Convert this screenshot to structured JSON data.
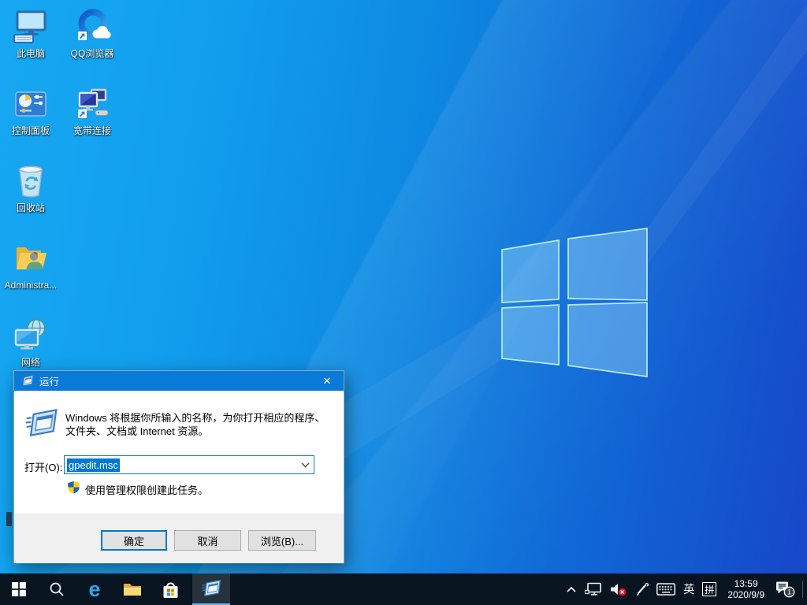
{
  "colors": {
    "accent": "#0078d7",
    "titlebar_blue": "#0a7ad9",
    "taskbar_bg": "#081420",
    "wallpaper_left": "#16a7f2",
    "wallpaper_right": "#1747c8",
    "selection_bg": "#0078d7",
    "mute_badge_red": "#e81123"
  },
  "icons": {
    "close": "✕",
    "edge": "e"
  },
  "desktop": {
    "icons": [
      {
        "label": "此电脑"
      },
      {
        "label": "QQ浏览器"
      },
      {
        "label": "控制面板"
      },
      {
        "label": "宽带连接"
      },
      {
        "label": "回收站"
      },
      {
        "label": "Administra..."
      },
      {
        "label": "网络"
      }
    ]
  },
  "run_dialog": {
    "title": "运行",
    "description_line1": "Windows 将根据你所输入的名称，为你打开相应的程序、",
    "description_line2": "文件夹、文档或 Internet 资源。",
    "open_label": "打开(O):",
    "input_value": "gpedit.msc",
    "uac_note": "使用管理权限创建此任务。",
    "ok_label": "确定",
    "cancel_label": "取消",
    "browse_label": "浏览(B)..."
  },
  "taskbar": {
    "tray": {
      "ime_latin": "英",
      "ime_pinyin": "拼",
      "time": "13:59",
      "date": "2020/9/9",
      "notification_count": "1"
    }
  }
}
